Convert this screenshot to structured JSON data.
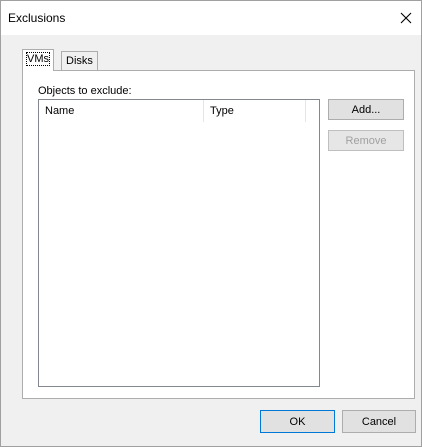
{
  "window": {
    "title": "Exclusions"
  },
  "tabs": [
    {
      "label": "VMs",
      "selected": true
    },
    {
      "label": "Disks",
      "selected": false
    }
  ],
  "panel": {
    "section_label": "Objects to exclude:",
    "columns": [
      "Name",
      "Type"
    ],
    "rows": []
  },
  "side_buttons": {
    "add": "Add...",
    "remove": "Remove"
  },
  "footer": {
    "ok": "OK",
    "cancel": "Cancel"
  },
  "colors": {
    "disabled_text": "#a0a0a0",
    "focus_border": "#0078d7"
  }
}
